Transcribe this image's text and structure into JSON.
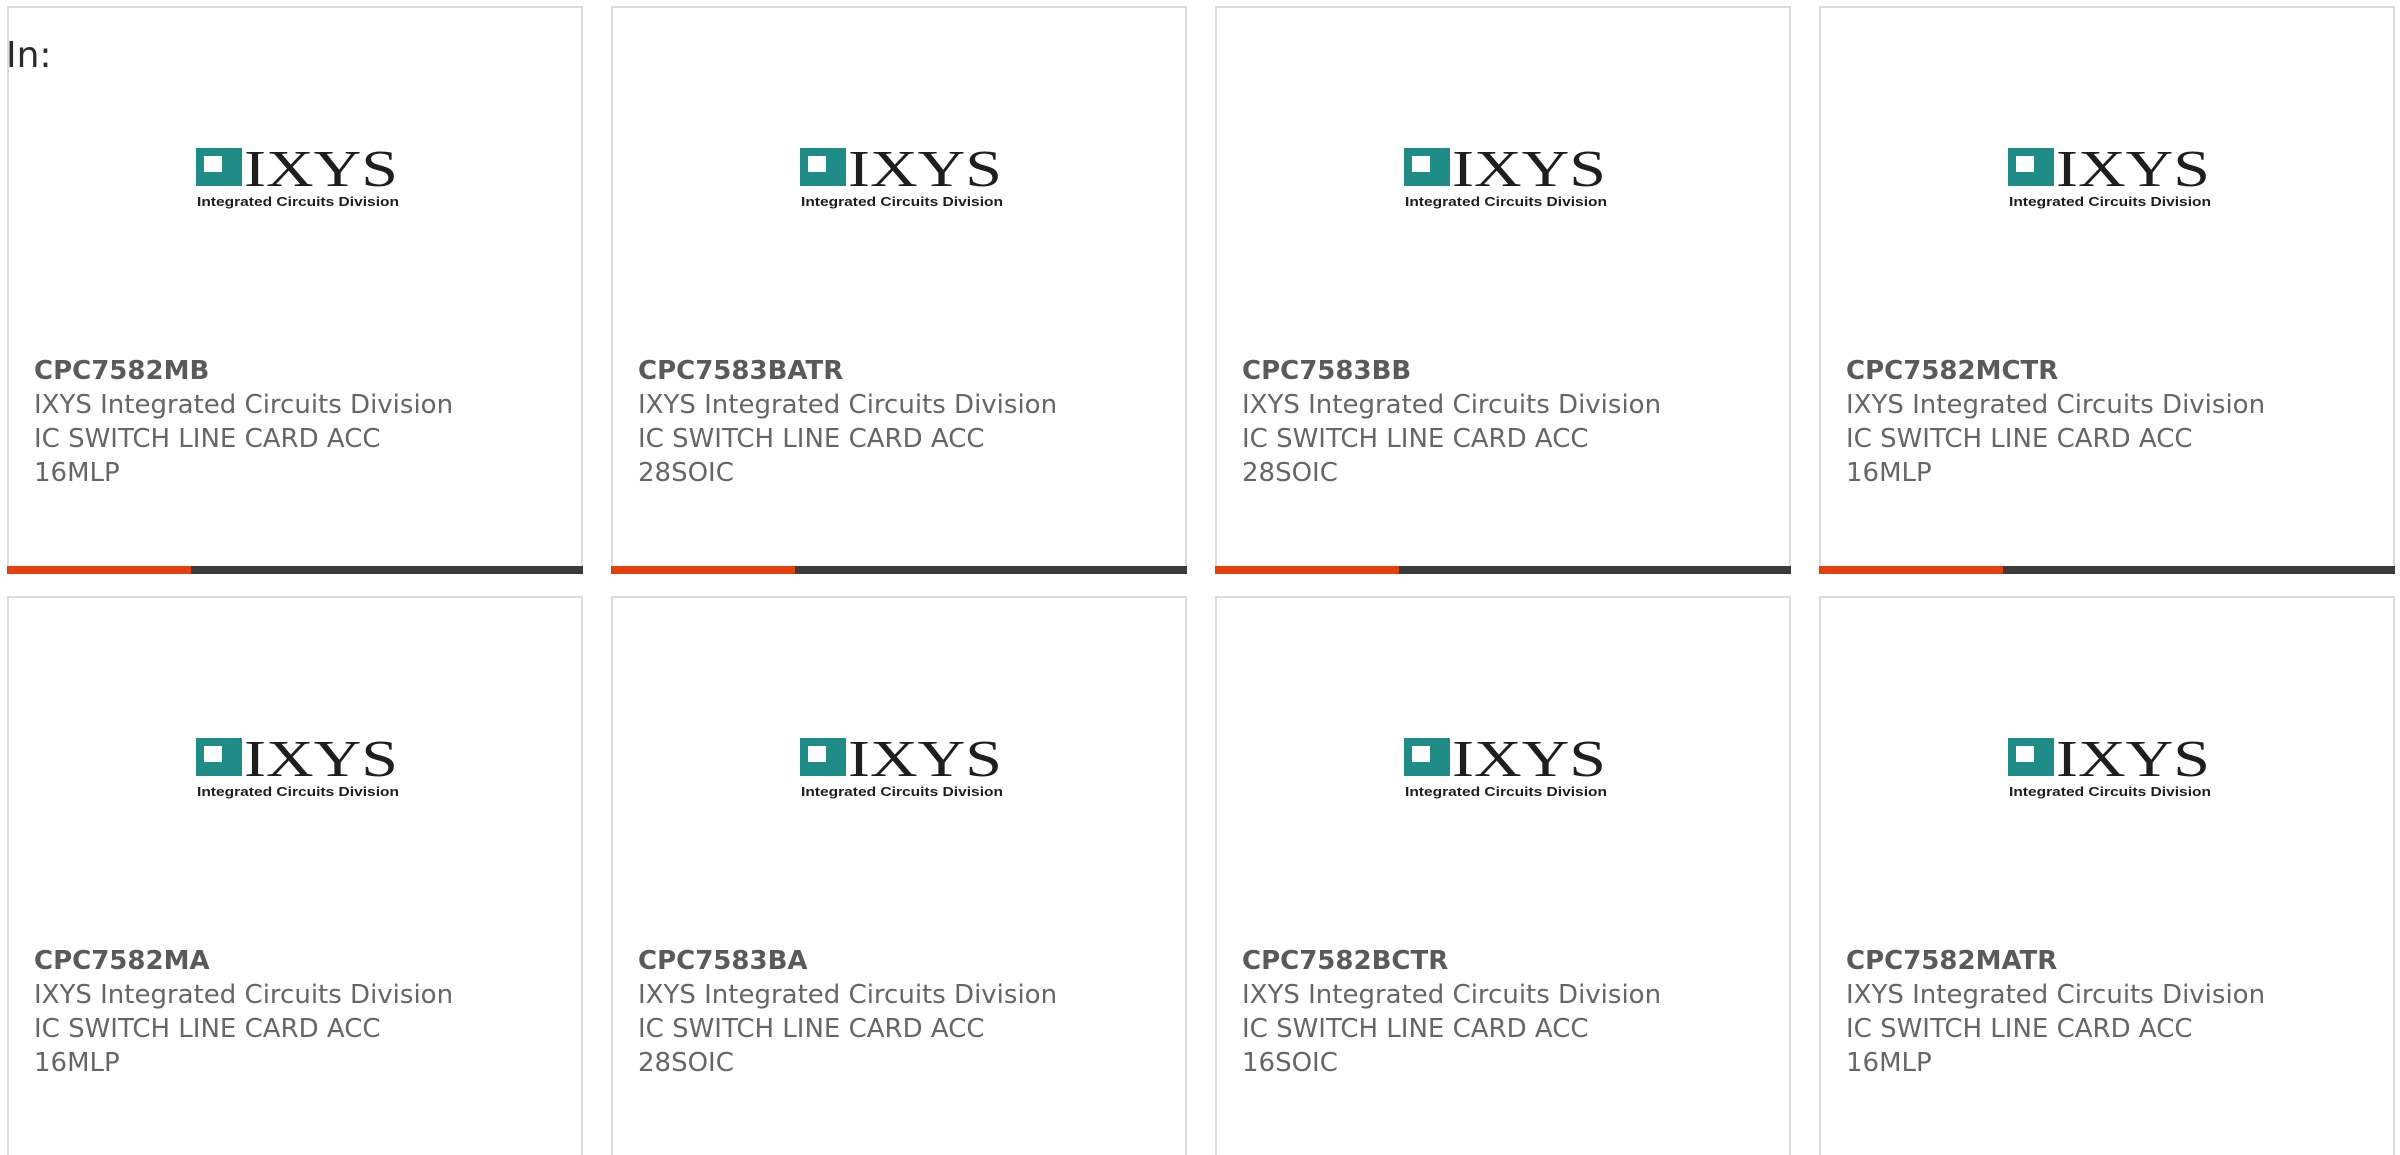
{
  "header": {
    "in_label": "In:"
  },
  "colors": {
    "accent": "#e4400d",
    "bar": "#3c3c3c",
    "logo_teal": "#1f8c88"
  },
  "logo": {
    "icon": "ixys-logo-icon",
    "wordmark": "IXYS",
    "tagline": "Integrated Circuits Division"
  },
  "cards": [
    {
      "part": "CPC7582MB",
      "mfr": "IXYS Integrated Circuits Division",
      "desc": "IC SWITCH LINE CARD ACC",
      "pkg": "16MLP"
    },
    {
      "part": "CPC7583BATR",
      "mfr": "IXYS Integrated Circuits Division",
      "desc": "IC SWITCH LINE CARD ACC",
      "pkg": "28SOIC"
    },
    {
      "part": "CPC7583BB",
      "mfr": "IXYS Integrated Circuits Division",
      "desc": "IC SWITCH LINE CARD ACC",
      "pkg": "28SOIC"
    },
    {
      "part": "CPC7582MCTR",
      "mfr": "IXYS Integrated Circuits Division",
      "desc": "IC SWITCH LINE CARD ACC",
      "pkg": "16MLP"
    },
    {
      "part": "CPC7582MA",
      "mfr": "IXYS Integrated Circuits Division",
      "desc": "IC SWITCH LINE CARD ACC",
      "pkg": "16MLP"
    },
    {
      "part": "CPC7583BA",
      "mfr": "IXYS Integrated Circuits Division",
      "desc": "IC SWITCH LINE CARD ACC",
      "pkg": "28SOIC"
    },
    {
      "part": "CPC7582BCTR",
      "mfr": "IXYS Integrated Circuits Division",
      "desc": "IC SWITCH LINE CARD ACC",
      "pkg": "16SOIC"
    },
    {
      "part": "CPC7582MATR",
      "mfr": "IXYS Integrated Circuits Division",
      "desc": "IC SWITCH LINE CARD ACC",
      "pkg": "16MLP"
    }
  ]
}
